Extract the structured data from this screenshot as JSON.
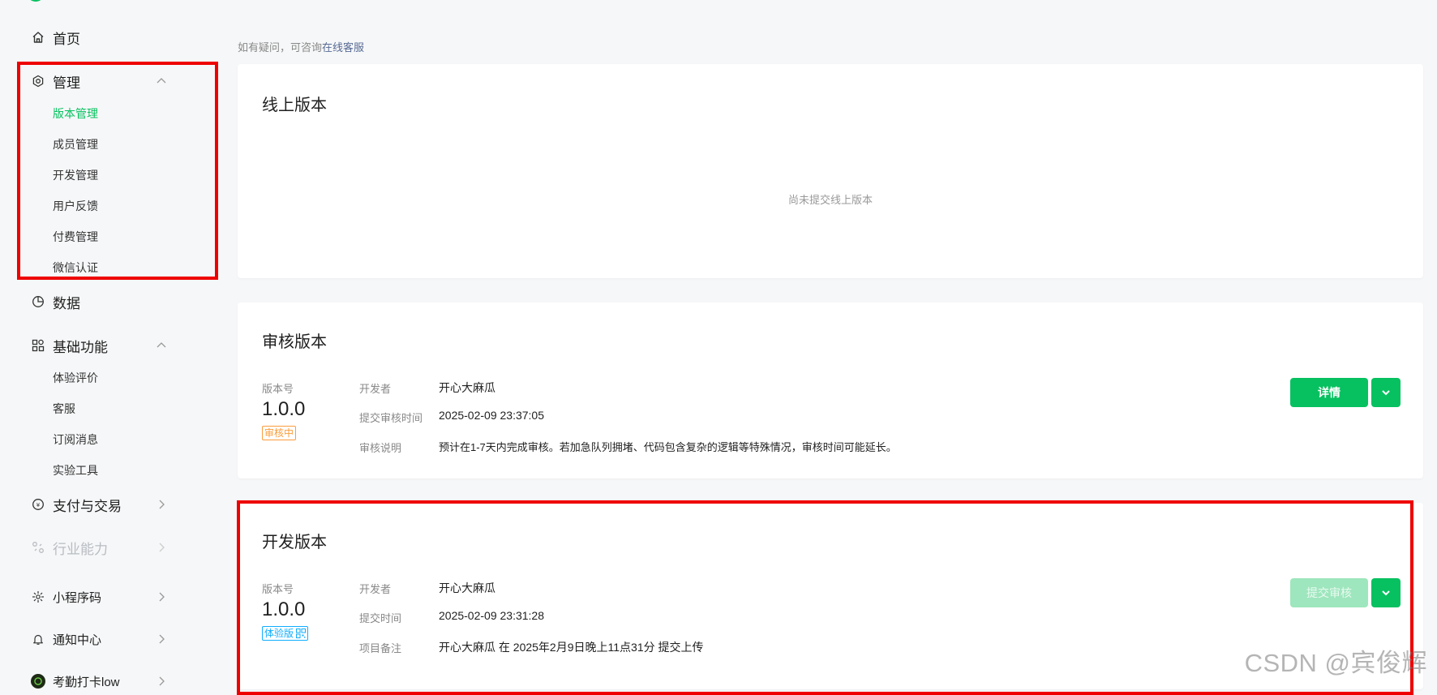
{
  "sidebar": {
    "home": "首页",
    "manage": {
      "label": "管理",
      "items": [
        {
          "label": "版本管理",
          "active": true
        },
        {
          "label": "成员管理"
        },
        {
          "label": "开发管理"
        },
        {
          "label": "用户反馈"
        },
        {
          "label": "付费管理"
        },
        {
          "label": "微信认证"
        }
      ]
    },
    "data": "数据",
    "basic": {
      "label": "基础功能",
      "items": [
        {
          "label": "体验评价"
        },
        {
          "label": "客服"
        },
        {
          "label": "订阅消息"
        },
        {
          "label": "实验工具"
        }
      ]
    },
    "payment": "支付与交易",
    "industry": "行业能力",
    "miniprogram_code": "小程序码",
    "notifications": "通知中心",
    "account": "考勤打卡low"
  },
  "hint": {
    "prefix": "如有疑问，可咨询",
    "link": "在线客服"
  },
  "online": {
    "title": "线上版本",
    "empty": "尚未提交线上版本"
  },
  "review": {
    "title": "审核版本",
    "version_label": "版本号",
    "version": "1.0.0",
    "badge": "审核中",
    "fields": [
      {
        "label": "开发者",
        "value": "开心大麻瓜"
      },
      {
        "label": "提交审核时间",
        "value": "2025-02-09 23:37:05"
      },
      {
        "label": "审核说明",
        "value": "预计在1-7天内完成审核。若加急队列拥堵、代码包含复杂的逻辑等特殊情况，审核时间可能延长。"
      }
    ],
    "detail_button": "详情"
  },
  "dev": {
    "title": "开发版本",
    "version_label": "版本号",
    "version": "1.0.0",
    "badge": "体验版",
    "fields": [
      {
        "label": "开发者",
        "value": "开心大麻瓜"
      },
      {
        "label": "提交时间",
        "value": "2025-02-09 23:31:28"
      },
      {
        "label": "项目备注",
        "value": "开心大麻瓜 在 2025年2月9日晚上11点31分 提交上传"
      }
    ],
    "submit_button": "提交审核"
  },
  "watermark": "CSDN @宾俊辉",
  "colors": {
    "brand": "#07c160",
    "highlight": "#ee0000",
    "badge_review": "#fa9d3b",
    "badge_trial": "#10aeff"
  }
}
